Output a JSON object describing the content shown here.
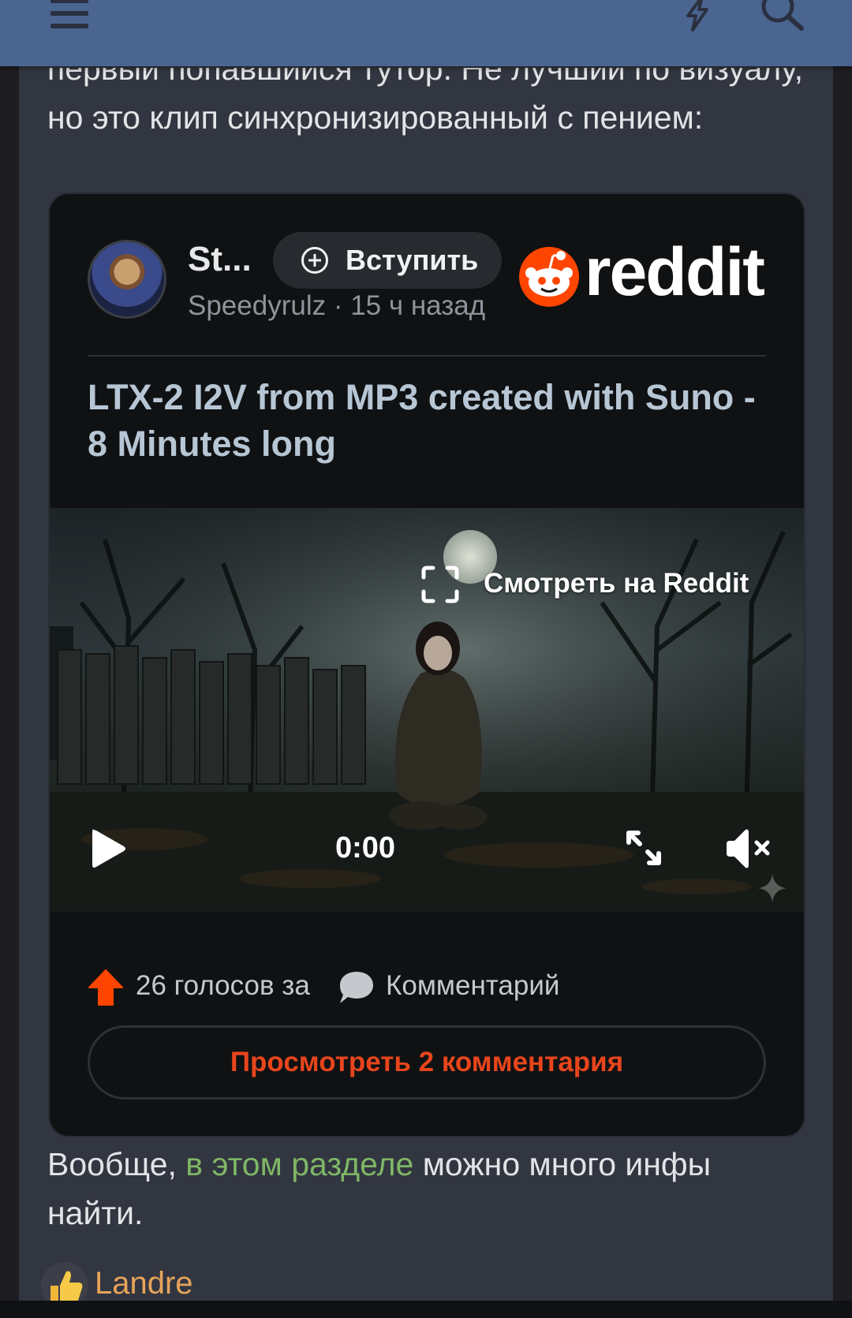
{
  "post": {
    "top_text": "первый попавшийся тутор. Не лучший по визуалу, но это клип синхронизированный с пением:",
    "bottom_text_before": "Вообще, ",
    "bottom_link": "в этом разделе",
    "bottom_text_after": " можно много инфы найти."
  },
  "embed": {
    "subreddit": "St...",
    "join_label": "Вступить",
    "meta": "Speedyrulz · 15 ч назад",
    "brand": "reddit",
    "title": "LTX-2 I2V from MP3 created with Suno - 8 Minutes long",
    "watch_label": "Смотреть на Reddit",
    "time": "0:00",
    "votes": "26 голосов за",
    "comments": "Комментарий",
    "view_comments": "Просмотреть 2 комментария"
  },
  "reply": {
    "user": "Landre"
  },
  "colors": {
    "header": "#4a6590",
    "reddit_orange": "#ff4500",
    "link_green": "#7fb766",
    "username_orange": "#e7a45a"
  }
}
